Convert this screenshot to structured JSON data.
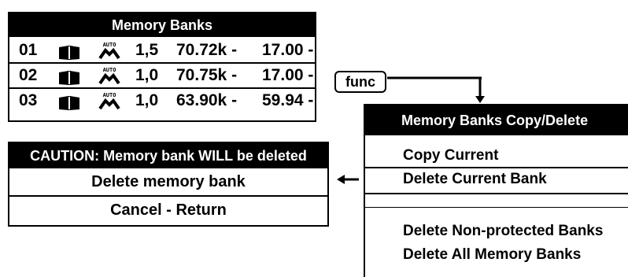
{
  "banks": {
    "title": "Memory Banks",
    "rows": [
      {
        "num": "01",
        "book_icon": "book-icon",
        "auto_icon": "auto-icon",
        "auto_text": "AUTO",
        "res": "1,5",
        "freq": "70.72k -",
        "val": "17.00 -"
      },
      {
        "num": "02",
        "book_icon": "book-icon",
        "auto_icon": "auto-icon",
        "auto_text": "AUTO",
        "res": "1,0",
        "freq": "70.75k -",
        "val": "17.00 -"
      },
      {
        "num": "03",
        "book_icon": "book-icon",
        "auto_icon": "auto-icon",
        "auto_text": "AUTO",
        "res": "1,0",
        "freq": "63.90k -",
        "val": "59.94 -"
      }
    ]
  },
  "func": {
    "label": "func"
  },
  "caution": {
    "title": "CAUTION: Memory bank WILL be deleted",
    "delete_label": "Delete memory bank",
    "cancel_label": "Cancel - Return"
  },
  "copydel": {
    "title": "Memory Banks Copy/Delete",
    "items": [
      "Copy Current",
      "Delete Current Bank",
      "Delete Non-protected Banks",
      "Delete All Memory Banks"
    ]
  }
}
